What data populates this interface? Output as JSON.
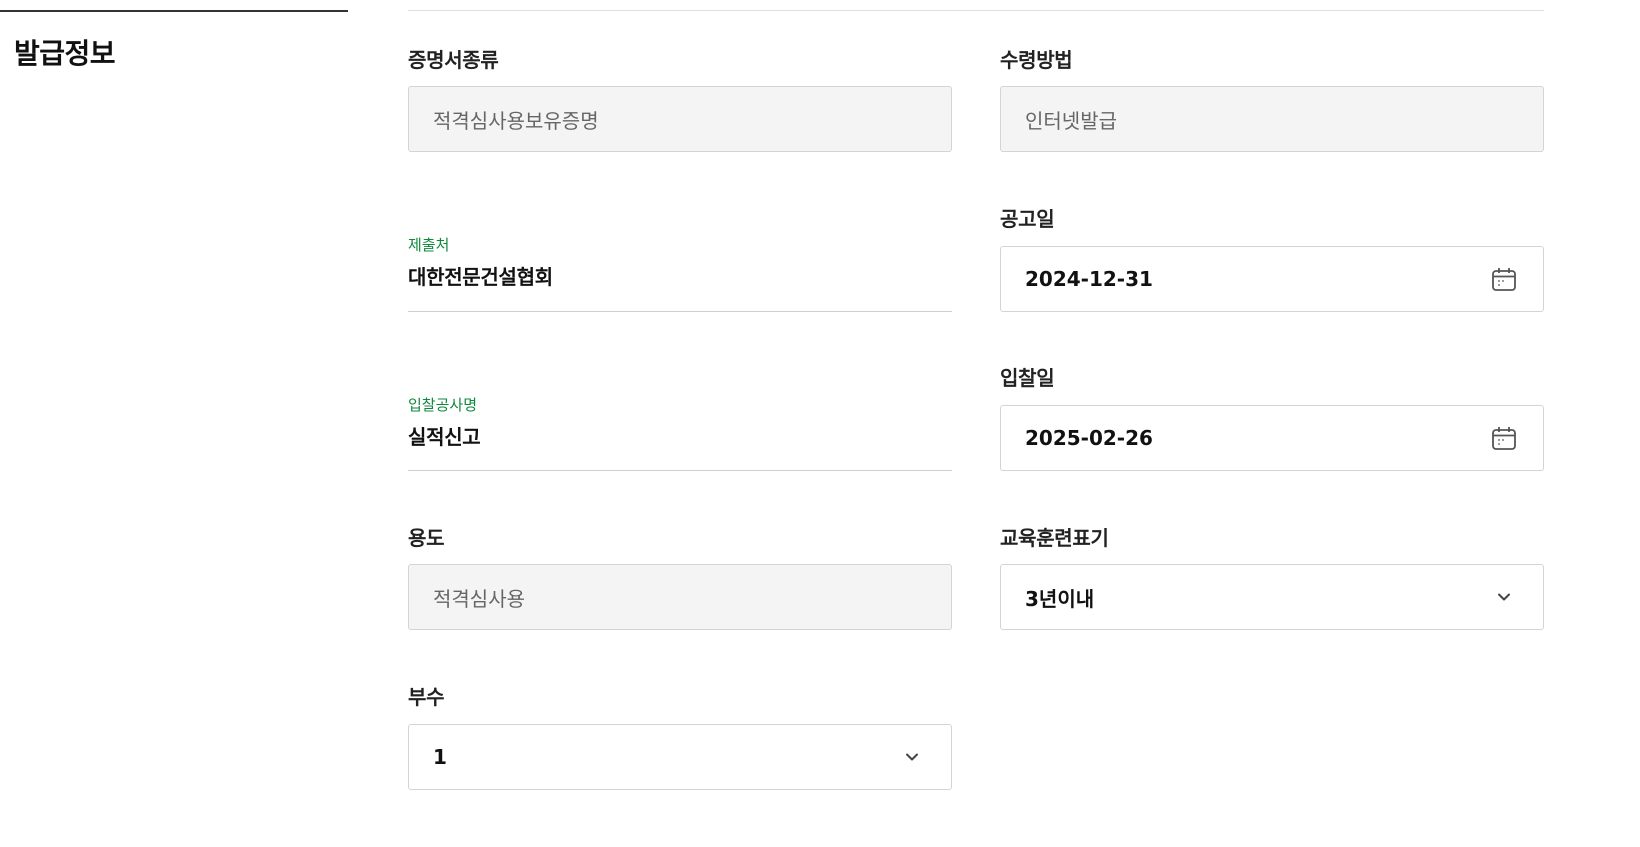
{
  "section": {
    "title": "발급정보"
  },
  "fields": {
    "cert_type": {
      "label": "증명서종류",
      "value": "적격심사용보유증명"
    },
    "receive_method": {
      "label": "수령방법",
      "value": "인터넷발급"
    },
    "submit_to": {
      "label": "제출처",
      "value": "대한전문건설협회"
    },
    "notice_date": {
      "label": "공고일",
      "value": "2024-12-31",
      "icon": "calendar-icon"
    },
    "bid_name": {
      "label": "입찰공사명",
      "value": "실적신고"
    },
    "bid_date": {
      "label": "입찰일",
      "value": "2025-02-26",
      "icon": "calendar-icon"
    },
    "purpose": {
      "label": "용도",
      "value": "적격심사용"
    },
    "training_display": {
      "label": "교육훈련표기",
      "value": "3년이내",
      "icon": "chevron-down-icon"
    },
    "copies": {
      "label": "부수",
      "value": "1",
      "icon": "chevron-down-icon"
    }
  },
  "colors": {
    "accent_green": "#0f8a3c",
    "readonly_bg": "#f4f4f4",
    "border": "#d4d4d4"
  }
}
